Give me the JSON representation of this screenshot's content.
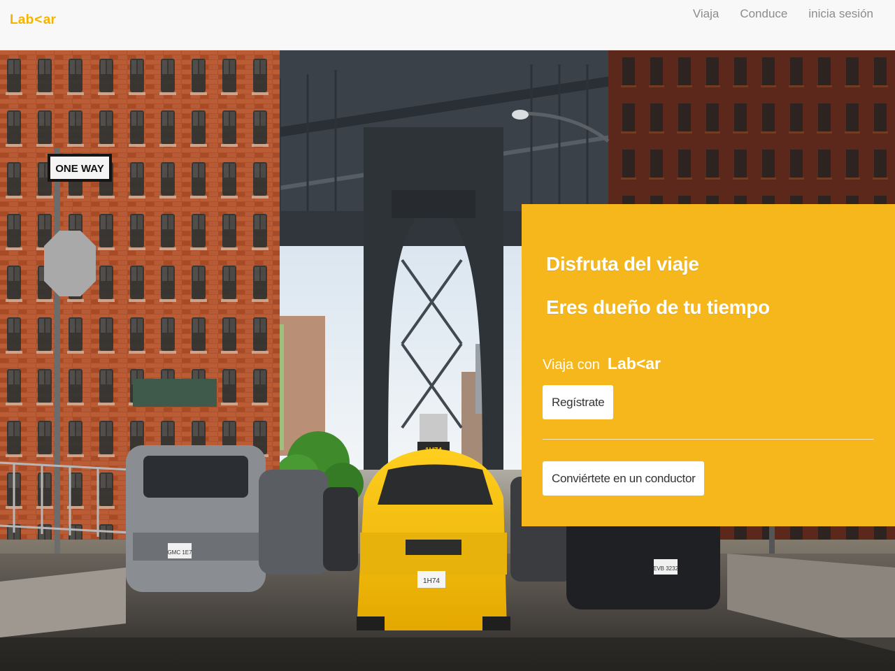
{
  "brand": {
    "logo_prefix": "Lab",
    "logo_chevron": "<",
    "logo_suffix": "ar",
    "color": "#f5b400"
  },
  "nav": {
    "items": [
      {
        "label": "Viaja"
      },
      {
        "label": "Conduce"
      },
      {
        "label": "inicia sesión"
      }
    ]
  },
  "hero": {
    "background_image": "city street under bridge with yellow taxi",
    "street_sign": "ONE WAY",
    "taxi_roof_sign": "1H74",
    "taxi_plate": "1H74",
    "car_plate_left": "GMC 1E7",
    "car_plate_right": "EVB 3232"
  },
  "panel": {
    "background_color": "#f5b71b",
    "headline_1": "Disfruta del viaje",
    "headline_2": "Eres dueño de tu tiempo",
    "travel_with": "Viaja con",
    "register_button": "Regístrate",
    "driver_button": "Conviértete en un conductor"
  }
}
